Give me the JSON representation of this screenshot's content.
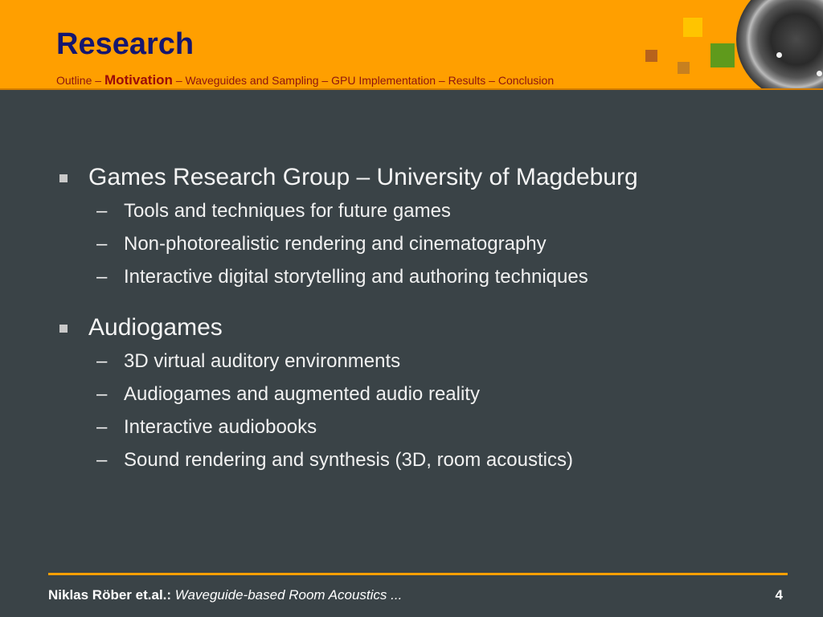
{
  "slide": {
    "title": "Research",
    "breadcrumb": {
      "before": "Outline – ",
      "active": "Motivation",
      "after": " – Waveguides and Sampling – GPU Implementation – Results – Conclusion"
    },
    "bullets": [
      {
        "text": "Games Research Group – University of Magdeburg",
        "sub": [
          "Tools and techniques for future games",
          "Non-photorealistic rendering and cinematography",
          "Interactive digital storytelling and authoring techniques"
        ]
      },
      {
        "text": "Audiogames",
        "sub": [
          "3D virtual auditory environments",
          "Audiogames and augmented audio reality",
          "Interactive audiobooks",
          "Sound rendering and synthesis (3D, room acoustics)"
        ]
      }
    ],
    "sub_marker": "–"
  },
  "footer": {
    "author": "Niklas Röber et.al.:",
    "work": "Waveguide-based Room Acoustics ...",
    "page": "4"
  },
  "colors": {
    "header_bg": "#ff9f00",
    "body_bg": "#3a4347",
    "title": "#15166f",
    "breadcrumb": "#8c1410"
  },
  "icons": {
    "speaker": "speaker-icon",
    "bullet": "square-bullet-icon"
  }
}
